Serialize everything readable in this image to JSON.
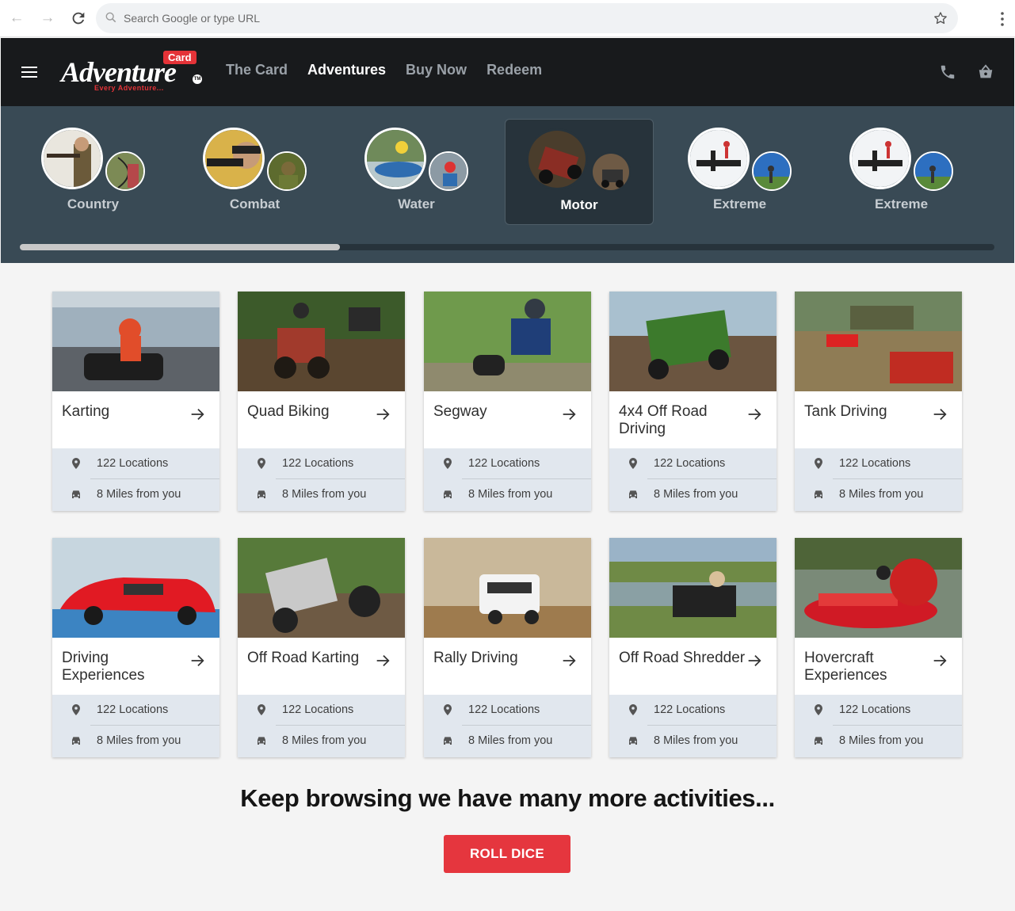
{
  "browser": {
    "url_placeholder": "Search Google or type URL"
  },
  "header": {
    "logo": {
      "word": "Adventure",
      "card": "Card",
      "tagline": "Every Adventure...",
      "tm": "TM"
    },
    "nav": [
      {
        "label": "The Card",
        "active": false
      },
      {
        "label": "Adventures",
        "active": true
      },
      {
        "label": "Buy Now",
        "active": false
      },
      {
        "label": "Redeem",
        "active": false
      }
    ]
  },
  "categories": [
    {
      "label": "Country",
      "active": false
    },
    {
      "label": "Combat",
      "active": false
    },
    {
      "label": "Water",
      "active": false
    },
    {
      "label": "Motor",
      "active": true
    },
    {
      "label": "Extreme",
      "active": false
    },
    {
      "label": "Extreme",
      "active": false
    }
  ],
  "cards": [
    {
      "title": "Karting",
      "locations": "122 Locations",
      "distance": "8 Miles from you"
    },
    {
      "title": "Quad Biking",
      "locations": "122 Locations",
      "distance": "8 Miles from you"
    },
    {
      "title": "Segway",
      "locations": "122 Locations",
      "distance": "8 Miles from you"
    },
    {
      "title": "4x4 Off Road Driving",
      "locations": "122 Locations",
      "distance": "8 Miles from you"
    },
    {
      "title": "Tank Driving",
      "locations": "122 Locations",
      "distance": "8 Miles from you"
    },
    {
      "title": "Driving Experiences",
      "locations": "122 Locations",
      "distance": "8 Miles from you"
    },
    {
      "title": "Off Road Karting",
      "locations": "122 Locations",
      "distance": "8 Miles from you"
    },
    {
      "title": "Rally Driving",
      "locations": "122 Locations",
      "distance": "8 Miles from you"
    },
    {
      "title": "Off Road Shredder",
      "locations": "122 Locations",
      "distance": "8 Miles from you"
    },
    {
      "title": "Hovercraft Experiences",
      "locations": "122 Locations",
      "distance": "8 Miles from you"
    }
  ],
  "footer": {
    "headline": "Keep browsing we have many more activities...",
    "button": "ROLL DICE"
  },
  "colors": {
    "header": "#181a1c",
    "strip": "#394a55",
    "accent": "#e5363e",
    "meta": "#e1e7ee"
  }
}
